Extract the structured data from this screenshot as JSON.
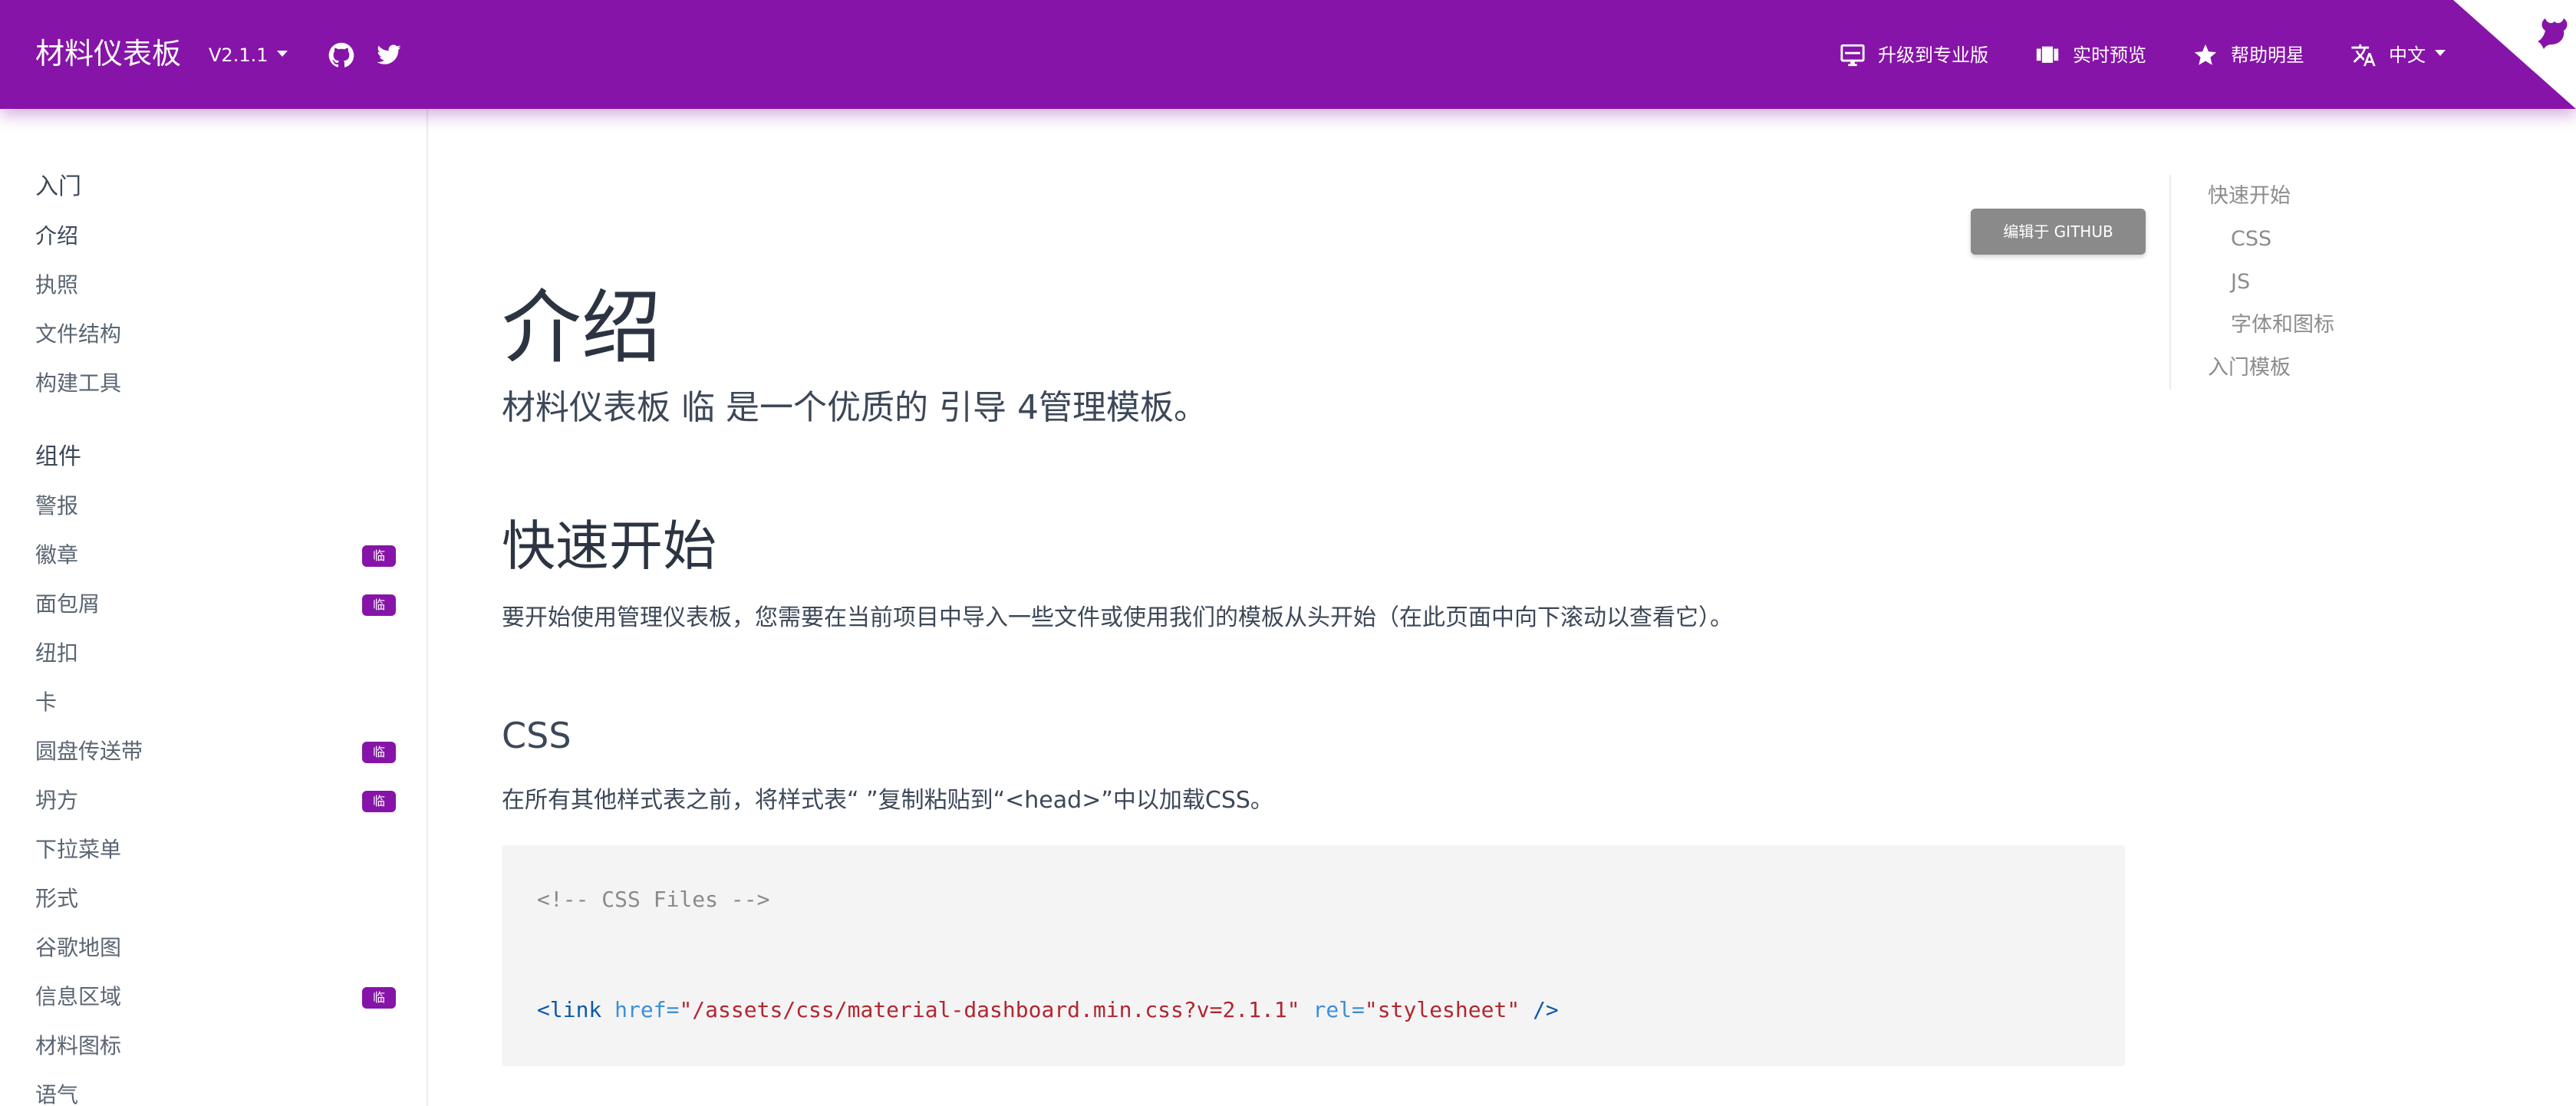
{
  "navbar": {
    "brand": "材料仪表板",
    "version": "V2.1.1",
    "links": [
      {
        "label": "升级到专业版",
        "icon": "monitor-icon"
      },
      {
        "label": "实时预览",
        "icon": "slides-icon"
      },
      {
        "label": "帮助明星",
        "icon": "star-icon"
      },
      {
        "label": "中文",
        "icon": "translate-icon"
      }
    ]
  },
  "sidebar": {
    "sections": [
      {
        "title": "入门",
        "items": [
          {
            "label": "介绍",
            "badge": ""
          },
          {
            "label": "执照",
            "badge": ""
          },
          {
            "label": "文件结构",
            "badge": ""
          },
          {
            "label": "构建工具",
            "badge": ""
          }
        ]
      },
      {
        "title": "组件",
        "items": [
          {
            "label": "警报",
            "badge": ""
          },
          {
            "label": "徽章",
            "badge": "临"
          },
          {
            "label": "面包屑",
            "badge": "临"
          },
          {
            "label": "纽扣",
            "badge": ""
          },
          {
            "label": "卡",
            "badge": ""
          },
          {
            "label": "圆盘传送带",
            "badge": "临"
          },
          {
            "label": "坍方",
            "badge": "临"
          },
          {
            "label": "下拉菜单",
            "badge": ""
          },
          {
            "label": "形式",
            "badge": ""
          },
          {
            "label": "谷歌地图",
            "badge": ""
          },
          {
            "label": "信息区域",
            "badge": "临"
          },
          {
            "label": "材料图标",
            "badge": ""
          },
          {
            "label": "语气",
            "badge": ""
          }
        ]
      }
    ]
  },
  "main": {
    "edit_button": "编辑于 GITHUB",
    "title": "介绍",
    "lead": "材料仪表板 临 是一个优质的 引导 4管理模板。",
    "quick_start_title": "快速开始",
    "quick_start_text": "要开始使用管理仪表板，您需要在当前项目中导入一些文件或使用我们的模板从头开始（在此页面中向下滚动以查看它）。",
    "css_title": "CSS",
    "css_text": "在所有其他样式表之前，将样式表“ ”复制粘贴到“<head>”中以加载CSS。",
    "code": {
      "comment": "<!-- CSS Files -->",
      "tag_open": "<link",
      "attr_href": "href=",
      "href_value": "\"/assets/css/material-dashboard.min.css?v=2.1.1\"",
      "attr_rel": "rel=",
      "rel_value": "\"stylesheet\"",
      "tag_close": "/>"
    }
  },
  "toc": {
    "items": [
      {
        "label": "快速开始",
        "level": 1
      },
      {
        "label": "CSS",
        "level": 2
      },
      {
        "label": "JS",
        "level": 2
      },
      {
        "label": "字体和图标",
        "level": 2
      },
      {
        "label": "入门模板",
        "level": 1
      }
    ]
  },
  "colors": {
    "primary": "#8714a8",
    "badge": "#8714a8",
    "edit_button": "#8a8a8a",
    "code_bg": "#f4f4f5"
  }
}
